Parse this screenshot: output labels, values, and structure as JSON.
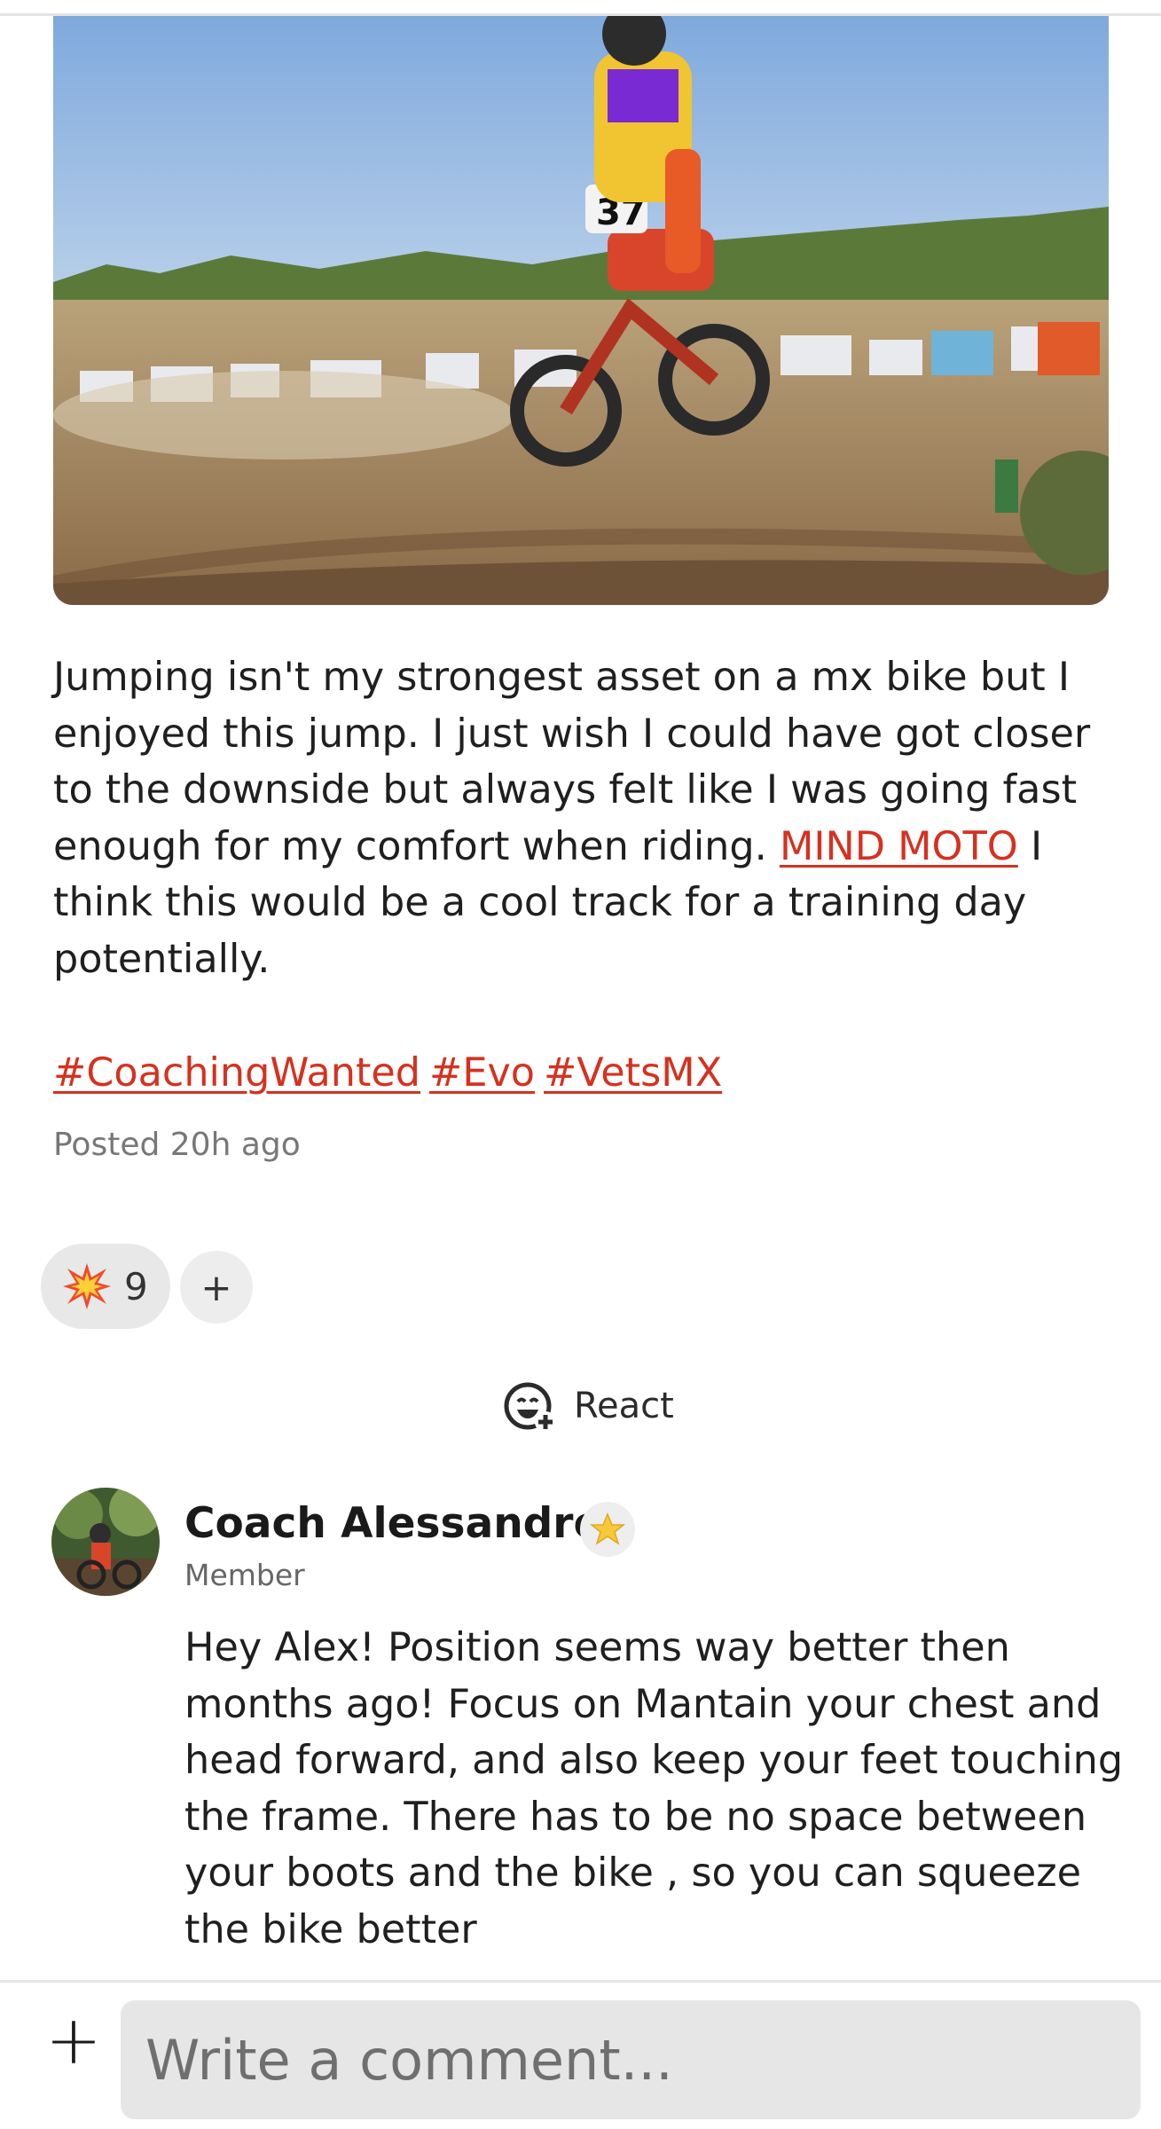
{
  "post": {
    "image_alt": "Motocross rider mid-jump on bike number 37",
    "body_before_mention": "Jumping isn't my strongest asset on a mx bike but I enjoyed this jump. I just wish I could have got closer to the downside but always felt like I was going fast enough for my comfort when riding. ",
    "mention": "MIND MOTO",
    "body_after_mention": " I think this would be a cool track for a training day potentially.",
    "hashtags": [
      "#CoachingWanted",
      "#Evo",
      "#VetsMX"
    ],
    "posted": "Posted 20h ago"
  },
  "reactions": {
    "emoji": "collision-icon",
    "count": "9",
    "add_label": "+",
    "react_label": "React"
  },
  "comment": {
    "author": "Coach Alessandro",
    "badge": "star-icon",
    "role": "Member",
    "text": "Hey Alex! Position seems way better then months ago! Focus on Mantain your chest and head forward, and also keep your feet touching the frame. There has to be no space between your boots and the bike , so you can squeeze the bike better"
  },
  "composer": {
    "add_label": "+",
    "placeholder": "Write a comment..."
  },
  "colors": {
    "link": "#d6311f",
    "chip": "#e8e8e8",
    "input_bg": "#e6e6e6"
  }
}
